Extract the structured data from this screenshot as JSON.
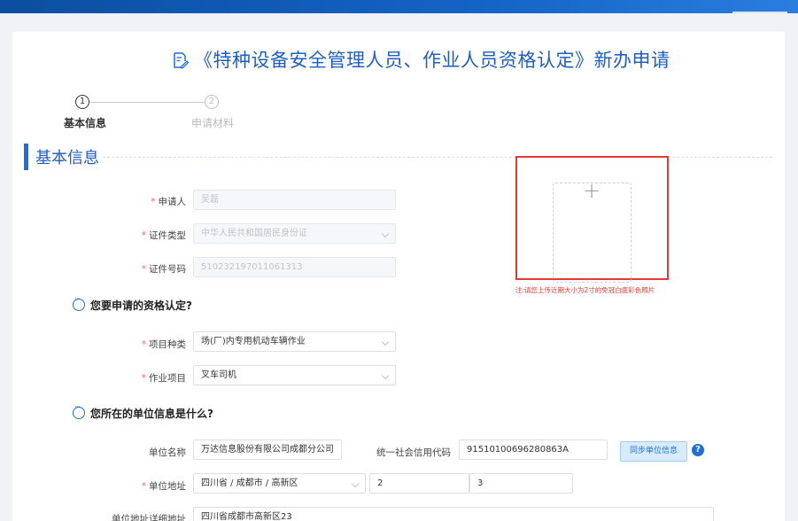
{
  "page": {
    "title": "《特种设备安全管理人员、作业人员资格认定》新办申请"
  },
  "steps": [
    {
      "num": "1",
      "label": "基本信息"
    },
    {
      "num": "2",
      "label": "申请材料"
    }
  ],
  "section": {
    "title": "基本信息"
  },
  "form": {
    "applicant": {
      "label": "申请人",
      "value": "吴磊"
    },
    "id_type": {
      "label": "证件类型",
      "value": "中华人民共和国居民身份证"
    },
    "id_number": {
      "label": "证件号码",
      "value": "510232197011061313"
    },
    "q1": "您要申请的资格认定?",
    "item_type": {
      "label": "项目种类",
      "value": "场(厂)内专用机动车辆作业"
    },
    "work_item": {
      "label": "作业项目",
      "value": "叉车司机"
    },
    "q2": "您所在的单位信息是什么?",
    "unit_name": {
      "label": "单位名称",
      "value": "万达信息股份有限公司成都分公司"
    },
    "credit_code": {
      "label": "统一社会信用代码",
      "value": "91510100696280863A"
    },
    "sync_button": "同步单位信息",
    "help": "?",
    "unit_address": {
      "label": "单位地址",
      "value": "四川省 / 成都市 / 高新区",
      "extra1": "2",
      "extra2": "3"
    },
    "address_detail": {
      "label": "单位地址详细地址",
      "value": "四川省成都市高新区23"
    }
  },
  "photo": {
    "plus": "+",
    "note": "注:请您上传近期大小为2寸的免冠白底彩色照片"
  }
}
